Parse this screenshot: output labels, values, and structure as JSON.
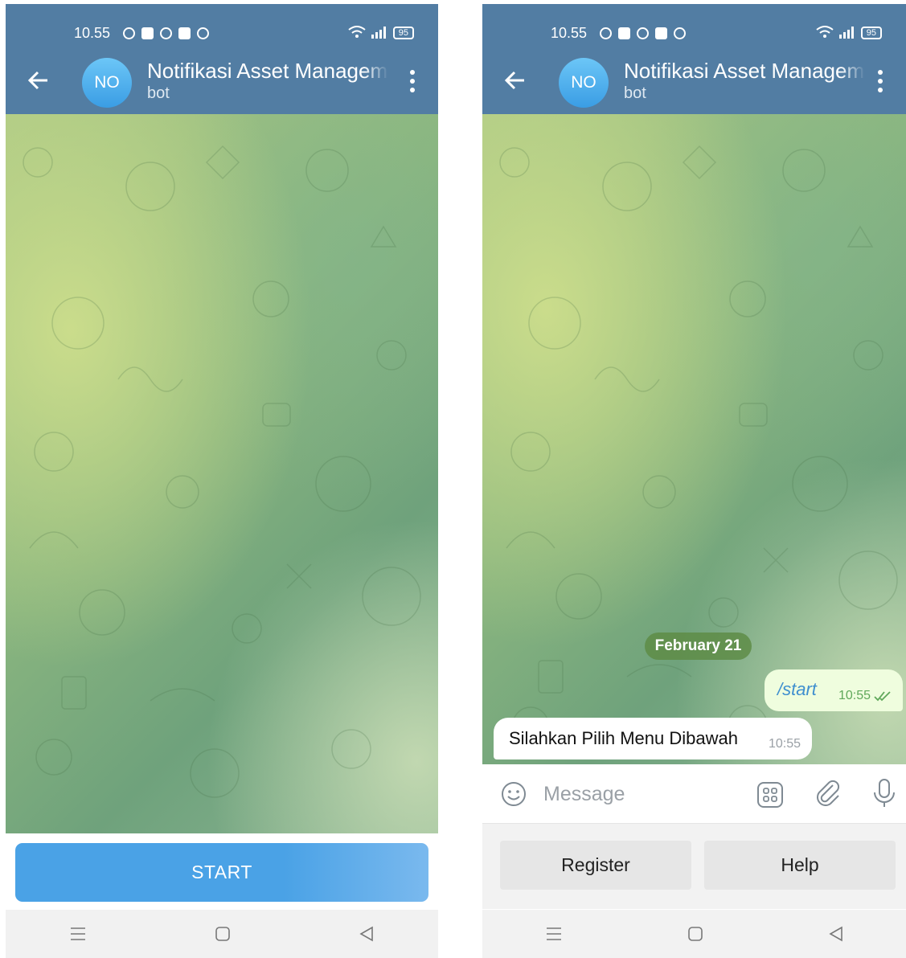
{
  "status_bar": {
    "time": "10.55",
    "battery": "95"
  },
  "chat_header": {
    "avatar_initials": "NO",
    "title": "Notifikasi Asset Management",
    "subtitle": "bot"
  },
  "left_screen": {
    "start_label": "START"
  },
  "right_screen": {
    "date_divider": "February 21",
    "messages": [
      {
        "direction": "outgoing",
        "text": "/start",
        "time": "10:55",
        "status": "read"
      },
      {
        "direction": "incoming",
        "text": "Silahkan Pilih Menu Dibawah",
        "time": "10:55"
      }
    ],
    "input": {
      "placeholder": "Message"
    },
    "keyboard_buttons": [
      "Register",
      "Help"
    ]
  },
  "icons": [
    "back-arrow-icon",
    "more-vertical-icon",
    "emoji-icon",
    "bot-commands-icon",
    "attach-icon",
    "mic-icon",
    "double-check-icon",
    "nav-menu-icon",
    "nav-home-icon",
    "nav-back-icon"
  ],
  "colors": {
    "header": "#527da3",
    "start_button": "#4aa2e6",
    "outgoing_bubble": "#effdde",
    "date_pill": "#5e8c46"
  }
}
